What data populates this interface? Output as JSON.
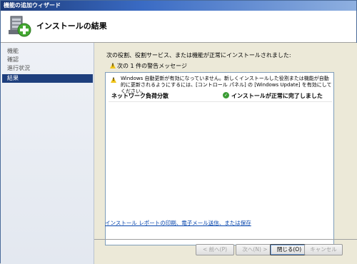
{
  "window": {
    "title": "機能の追加ウィザード"
  },
  "header": {
    "heading": "インストールの結果",
    "icon": "server-add-icon"
  },
  "nav": {
    "items": [
      {
        "label": "機能",
        "active": false
      },
      {
        "label": "確認",
        "active": false
      },
      {
        "label": "進行状況",
        "active": false
      },
      {
        "label": "結果",
        "active": true
      }
    ]
  },
  "main": {
    "intro": "次の役割、役割サービス、または機能が正常にインストールされました:",
    "warning_count": "次の 1 件の警告メッセージ",
    "notice": "Windows 自動更新が有効になっていません。新しくインストールした役割または機能が自動的に更新されるようにするには、[コントロール パネル] の [Windows Update] を有効にしてください。",
    "results": [
      {
        "name": "ネットワーク負荷分散",
        "status": "インストールが正常に完了しました",
        "status_icon": "check-icon"
      }
    ],
    "report_link": "インストール レポートの印刷、電子メール送信、または保存"
  },
  "buttons": {
    "back": "< 前へ(P)",
    "next": "次へ(N) >",
    "close": "閉じる(O)",
    "cancel": "キャンセル"
  },
  "colors": {
    "accent": "#1e3f7d",
    "warning": "#f0c419",
    "success": "#3a9c34",
    "link": "#0645ad"
  }
}
